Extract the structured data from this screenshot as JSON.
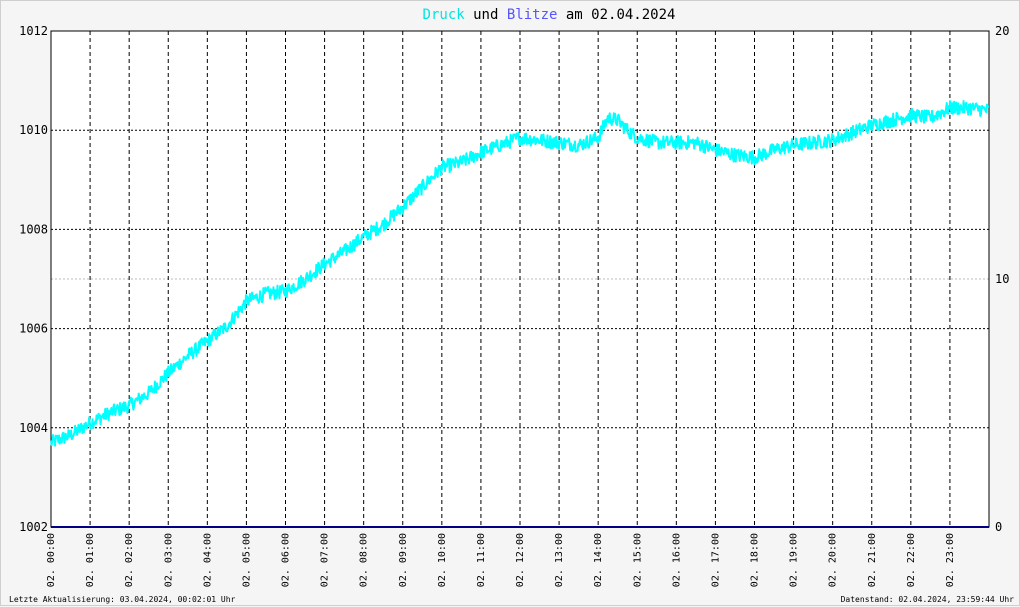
{
  "chart_data": {
    "type": "line",
    "title": {
      "part1": "Druck",
      "part2": " und ",
      "part3": "Blitze",
      "part4": " am 02.04.2024"
    },
    "colors": {
      "pressure": "#00ffff",
      "lightning": "#000080",
      "title_druck": "#00e5e5",
      "title_blitze": "#5555ff",
      "grid": "#000000",
      "background": "#ffffff"
    },
    "y_left": {
      "min": 1002,
      "max": 1012,
      "ticks": [
        "1002",
        "1004",
        "1006",
        "1008",
        "1010",
        "1012"
      ]
    },
    "y_right": {
      "min": 0,
      "max": 20,
      "ticks": [
        "0",
        "10",
        "20"
      ]
    },
    "x_hours": {
      "min": 0,
      "max": 24
    },
    "x_ticks": [
      "02. 00:00",
      "02. 01:00",
      "02. 02:00",
      "02. 03:00",
      "02. 04:00",
      "02. 05:00",
      "02. 06:00",
      "02. 07:00",
      "02. 08:00",
      "02. 09:00",
      "02. 10:00",
      "02. 11:00",
      "02. 12:00",
      "02. 13:00",
      "02. 14:00",
      "02. 15:00",
      "02. 16:00",
      "02. 17:00",
      "02. 18:00",
      "02. 19:00",
      "02. 20:00",
      "02. 21:00",
      "02. 22:00",
      "02. 23:00"
    ],
    "series": [
      {
        "name": "Druck",
        "axis": "left",
        "x": [
          0,
          0.5,
          1,
          1.5,
          2,
          2.5,
          3,
          3.5,
          4,
          4.5,
          5,
          5.5,
          6,
          6.5,
          7,
          7.5,
          8,
          8.5,
          9,
          9.5,
          10,
          10.5,
          11,
          11.5,
          12,
          12.5,
          13,
          13.5,
          14,
          14.25,
          14.5,
          14.75,
          15,
          15.5,
          16,
          16.5,
          17,
          17.5,
          18,
          18.5,
          19,
          19.5,
          20,
          20.5,
          21,
          21.5,
          22,
          22.5,
          23,
          23.5,
          24
        ],
        "y": [
          1003.7,
          1003.85,
          1004.1,
          1004.3,
          1004.45,
          1004.7,
          1005.1,
          1005.45,
          1005.75,
          1006.05,
          1006.55,
          1006.7,
          1006.75,
          1007.0,
          1007.3,
          1007.55,
          1007.85,
          1008.1,
          1008.45,
          1008.85,
          1009.25,
          1009.35,
          1009.55,
          1009.7,
          1009.85,
          1009.8,
          1009.75,
          1009.7,
          1009.85,
          1010.25,
          1010.2,
          1010.0,
          1009.85,
          1009.75,
          1009.75,
          1009.75,
          1009.6,
          1009.5,
          1009.45,
          1009.6,
          1009.7,
          1009.75,
          1009.8,
          1009.95,
          1010.1,
          1010.2,
          1010.3,
          1010.25,
          1010.45,
          1010.45,
          1010.4
        ]
      },
      {
        "name": "Blitze",
        "axis": "right",
        "x": [
          0,
          24
        ],
        "y": [
          0,
          0
        ]
      }
    ]
  },
  "footer": {
    "left": "Letzte Aktualisierung: 03.04.2024, 00:02:01 Uhr",
    "right": "Datenstand: 02.04.2024, 23:59:44 Uhr"
  }
}
